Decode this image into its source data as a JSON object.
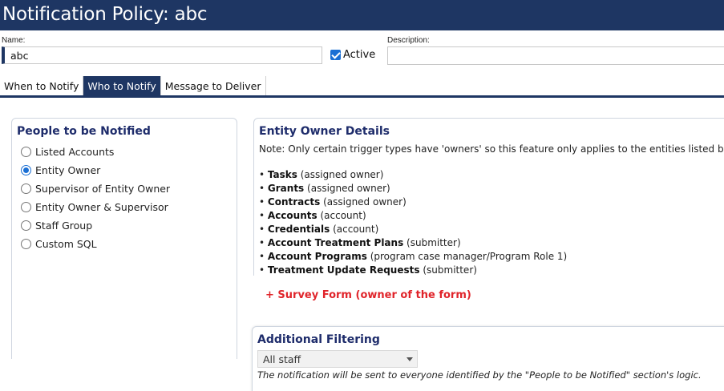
{
  "header": {
    "title": "Notification Policy: abc"
  },
  "form": {
    "name_label": "Name:",
    "name_value": "abc",
    "active_label": "Active",
    "description_label": "Description:",
    "description_value": ""
  },
  "tabs": [
    {
      "label": "When to Notify"
    },
    {
      "label": "Who to Notify",
      "active": true
    },
    {
      "label": "Message to Deliver"
    }
  ],
  "people": {
    "title": "People to be Notified",
    "options": [
      {
        "label": "Listed Accounts",
        "selected": false
      },
      {
        "label": "Entity Owner",
        "selected": true
      },
      {
        "label": "Supervisor of Entity Owner",
        "selected": false
      },
      {
        "label": "Entity Owner & Supervisor",
        "selected": false
      },
      {
        "label": "Staff Group",
        "selected": false
      },
      {
        "label": "Custom SQL",
        "selected": false
      }
    ]
  },
  "owner_details": {
    "title": "Entity Owner Details",
    "note": "Note: Only certain trigger types have 'owners' so this feature only applies to the entities listed below",
    "entities": [
      {
        "name": "Tasks",
        "detail": "(assigned owner)"
      },
      {
        "name": "Grants",
        "detail": "(assigned owner)"
      },
      {
        "name": "Contracts",
        "detail": "(assigned owner)"
      },
      {
        "name": "Accounts",
        "detail": "(account)"
      },
      {
        "name": "Credentials",
        "detail": "(account)"
      },
      {
        "name": "Account Treatment Plans",
        "detail": "(submitter)"
      },
      {
        "name": "Account Programs",
        "detail": "(program case manager/Program Role 1)"
      },
      {
        "name": "Treatment Update Requests",
        "detail": "(submitter)"
      }
    ],
    "survey_form": "+ Survey Form (owner of the form)"
  },
  "filtering": {
    "title": "Additional Filtering",
    "select_value": "All staff",
    "note": "The notification will be sent to everyone identified by the \"People to be Notified\" section's logic."
  },
  "colors": {
    "header_bg": "#1e3663",
    "accent": "#1a6fd4",
    "section_title": "#1e2c6b",
    "survey_red": "#e0242a"
  }
}
